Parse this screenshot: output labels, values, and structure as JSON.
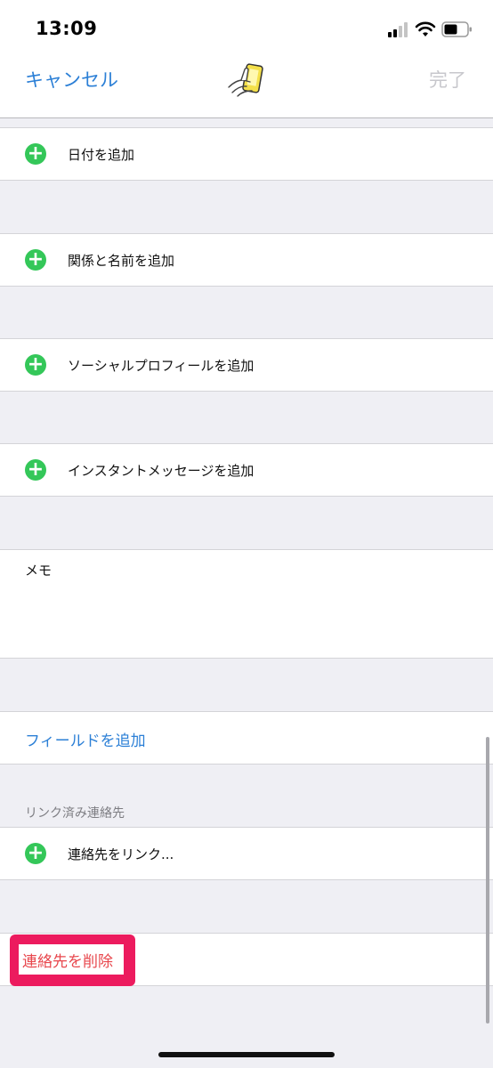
{
  "status_bar": {
    "time": "13:09"
  },
  "nav": {
    "cancel_label": "キャンセル",
    "done_label": "完了"
  },
  "rows": {
    "add_date": "日付を追加",
    "add_relation": "関係と名前を追加",
    "add_social": "ソーシャルプロフィールを追加",
    "add_im": "インスタントメッセージを追加"
  },
  "notes": {
    "label": "メモ"
  },
  "add_field": {
    "label": "フィールドを追加"
  },
  "linked": {
    "header": "リンク済み連絡先",
    "link_label": "連絡先をリンク..."
  },
  "delete": {
    "label": "連絡先を削除"
  },
  "icons": {
    "add": "plus-circle-icon",
    "app": "phone-hand-icon",
    "signal": "signal-icon",
    "wifi": "wifi-icon",
    "battery": "battery-icon"
  },
  "colors": {
    "accent": "#2b7fd6",
    "plus": "#34c759",
    "delete_text": "#e8474d",
    "highlight": "#ec1b5e"
  }
}
